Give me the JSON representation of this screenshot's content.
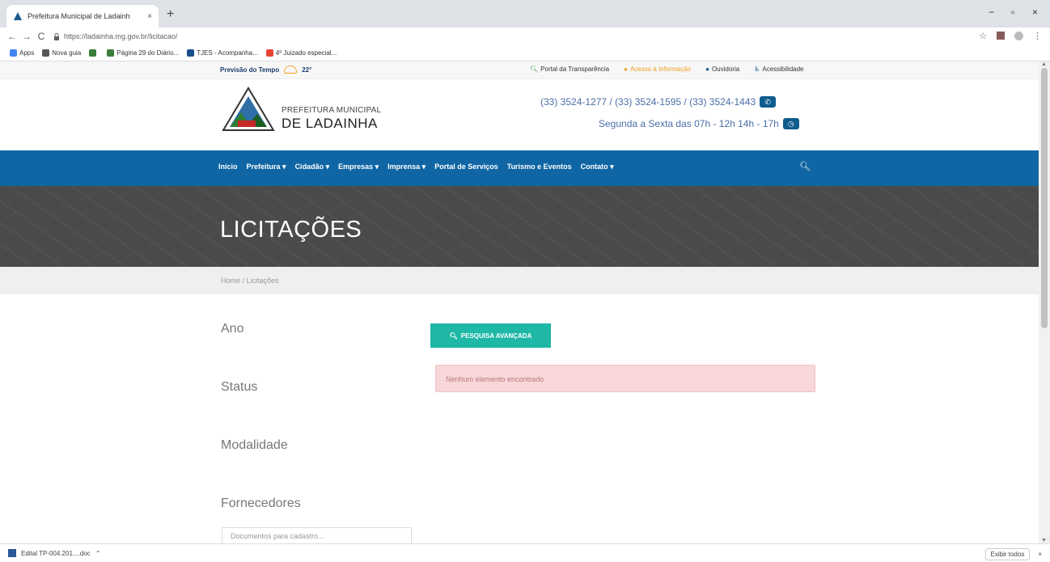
{
  "browser": {
    "tab_title": "Prefeitura Municipal de Ladainh",
    "tab_close": "×",
    "new_tab": "+",
    "url": "https://ladainha.mg.gov.br/licitacao/",
    "back": "←",
    "forward": "→",
    "reload": "C",
    "minimize": "−",
    "restore": "▫",
    "close": "×",
    "bookmarks": [
      {
        "label": "Apps",
        "color": "#4285f4"
      },
      {
        "label": "Nova guia",
        "color": "#555555"
      },
      {
        "label": "",
        "color": "#3a7d3a"
      },
      {
        "label": "Página 29 do Diário...",
        "color": "#3a7d3a"
      },
      {
        "label": "TJES - Acompanha...",
        "color": "#1c4e8a"
      },
      {
        "label": "4º Juizado especial...",
        "color": "#ea4335"
      }
    ]
  },
  "topbar": {
    "weather_label": "Previsão do Tempo",
    "temperature": "22°",
    "links": [
      "Portal da Transparência",
      "Acesso à Informação",
      "Ouvidoria",
      "Acessibilidade"
    ]
  },
  "header": {
    "brand_line1": "PREFEITURA MUNICIPAL",
    "brand_line2": "DE LADAINHA",
    "phones": "(33) 3524-1277 / (33) 3524-1595 / (33) 3524-1443",
    "hours": "Segunda a Sexta das 07h - 12h 14h - 17h"
  },
  "nav": {
    "items": [
      "Início",
      "Prefeitura ▾",
      "Cidadão ▾",
      "Empresas ▾",
      "Imprensa ▾",
      "Portal de Serviços",
      "Turismo e Eventos",
      "Contato ▾"
    ]
  },
  "hero": {
    "title": "LICITAÇÕES"
  },
  "breadcrumb": {
    "text": "Home / Licitações"
  },
  "filters": {
    "ano": "Ano",
    "status": "Status",
    "modalidade": "Modalidade",
    "fornecedores": "Fornecedores",
    "documents_placeholder": "Documentos para cadastro..."
  },
  "results": {
    "advanced_search": "PESQUISA AVANÇADA",
    "empty_message": "Nenhum elemento encontrado"
  },
  "downloads": {
    "file": "Edital TP-004.201....doc",
    "show_all": "Exibir todos",
    "close": "×"
  }
}
